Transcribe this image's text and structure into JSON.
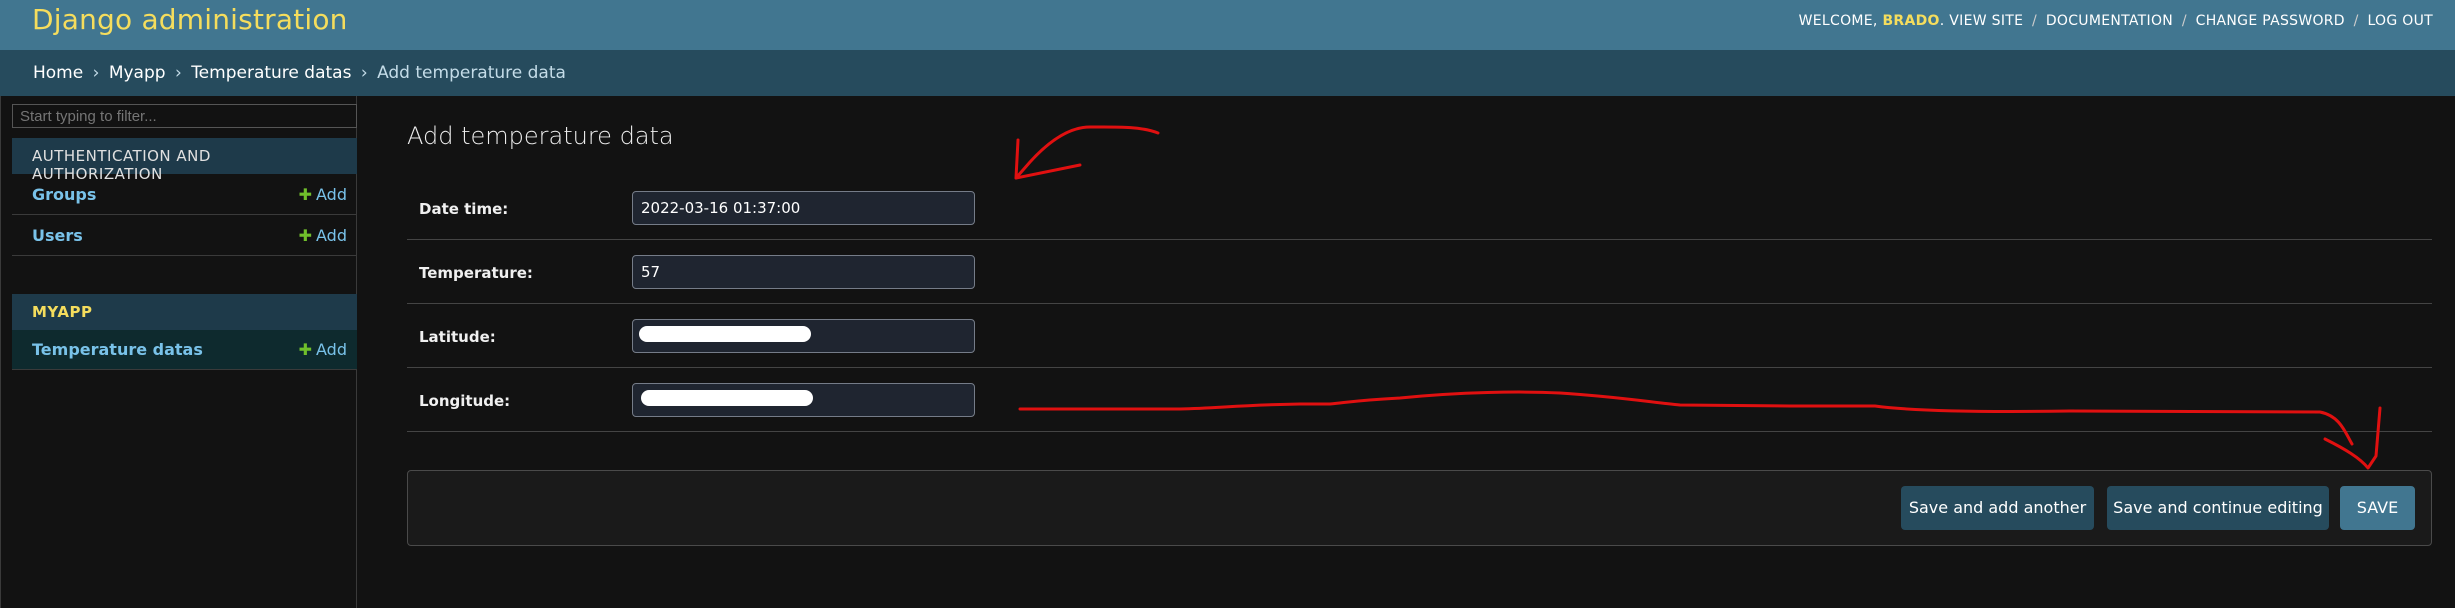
{
  "header": {
    "branding": "Django administration",
    "welcome": "WELCOME,",
    "username": "BRADO",
    "user_links": [
      "VIEW SITE",
      "DOCUMENTATION",
      "CHANGE PASSWORD",
      "LOG OUT"
    ]
  },
  "breadcrumbs": {
    "items": [
      "Home",
      "Myapp",
      "Temperature datas"
    ],
    "current": "Add temperature data",
    "separator": "›"
  },
  "sidebar": {
    "filter_placeholder": "Start typing to filter...",
    "modules": [
      {
        "caption": "AUTHENTICATION AND AUTHORIZATION",
        "models": [
          {
            "name": "Groups",
            "add": "Add"
          },
          {
            "name": "Users",
            "add": "Add"
          }
        ]
      },
      {
        "caption": "MYAPP",
        "models": [
          {
            "name": "Temperature datas",
            "add": "Add"
          }
        ]
      }
    ]
  },
  "form": {
    "title": "Add temperature data",
    "fields": [
      {
        "label": "Date time:",
        "value": "2022-03-16 01:37:00"
      },
      {
        "label": "Temperature:",
        "value": "57"
      },
      {
        "label": "Latitude:",
        "value": ""
      },
      {
        "label": "Longitude:",
        "value": ""
      }
    ],
    "buttons": {
      "save_add_another": "Save and add another",
      "save_continue": "Save and continue editing",
      "save": "SAVE"
    }
  },
  "colors": {
    "header_bg": "#417690",
    "branding": "#f5dd5d",
    "breadcrumbs_bg": "#264b5d",
    "link": "#79c2e9",
    "add_icon": "#70bf2b",
    "annotation": "#e01010"
  },
  "icons": {
    "add": "plus-icon"
  }
}
